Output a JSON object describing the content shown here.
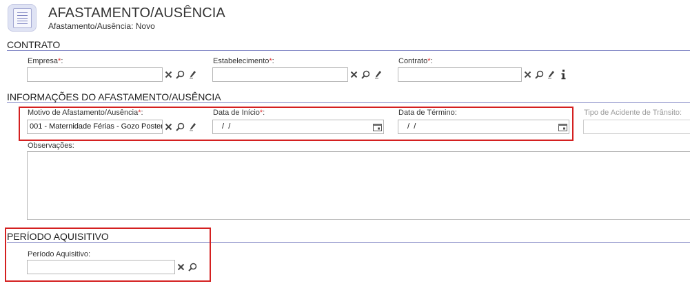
{
  "header": {
    "title": "AFASTAMENTO/AUSÊNCIA",
    "subtitle": "Afastamento/Ausência: Novo",
    "icon": "document-list-icon"
  },
  "sections": {
    "contrato": {
      "title": "CONTRATO",
      "fields": {
        "empresa": {
          "label": "Empresa",
          "required_mark": "*",
          "suffix": ":",
          "value": ""
        },
        "estabelecimento": {
          "label": "Estabelecimento",
          "required_mark": "*",
          "suffix": ":",
          "value": ""
        },
        "contrato": {
          "label": "Contrato",
          "required_mark": "*",
          "suffix": ":",
          "value": ""
        }
      }
    },
    "informacoes": {
      "title": "INFORMAÇÕES DO AFASTAMENTO/AUSÊNCIA",
      "fields": {
        "motivo": {
          "label": "Motivo de Afastamento/Ausência",
          "required_mark": "*",
          "suffix": ":",
          "value": "001 - Maternidade Férias - Gozo Poster"
        },
        "data_inicio": {
          "label": "Data de Início",
          "required_mark": "*",
          "suffix": ":",
          "value": " /  /"
        },
        "data_termino": {
          "label": "Data de Término:",
          "value": " /  /"
        },
        "tipo_acidente": {
          "label": "Tipo de Acidente de Trânsito:",
          "value": ""
        },
        "observacoes": {
          "label": "Observações:",
          "value": ""
        }
      }
    },
    "periodo": {
      "title": "PERÍODO AQUISITIVO",
      "fields": {
        "periodo_aquisitivo": {
          "label": "Período Aquisitivo:",
          "value": ""
        }
      }
    }
  },
  "icons": {
    "clear": "close-x-icon",
    "search": "magnifier-icon",
    "edit": "pencil-icon",
    "info": "info-icon",
    "calendar": "calendar-icon"
  },
  "colors": {
    "section_rule": "#8a8fc9",
    "required": "#e03030",
    "highlight": "#d42020"
  }
}
